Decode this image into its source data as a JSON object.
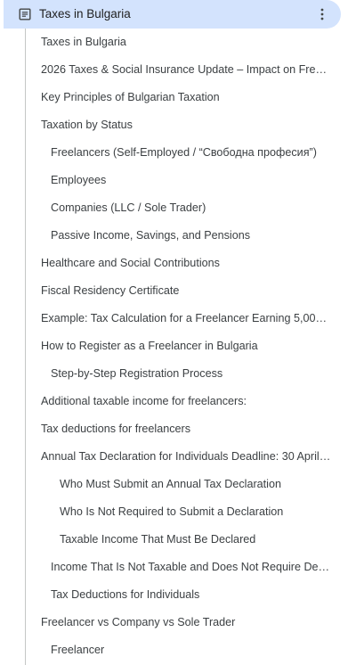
{
  "header": {
    "title": "Taxes in Bulgaria",
    "icon": "document-icon",
    "menu_icon": "more-vert-icon"
  },
  "outline": {
    "items": [
      {
        "label": "Taxes in Bulgaria",
        "level": 0
      },
      {
        "label": "2026 Taxes & Social Insurance Update – Impact on Freel…",
        "level": 0
      },
      {
        "label": "Key Principles of Bulgarian Taxation",
        "level": 0
      },
      {
        "label": "Taxation by Status",
        "level": 0
      },
      {
        "label": "Freelancers (Self-Employed / “Свободна професия”)",
        "level": 1
      },
      {
        "label": "Employees",
        "level": 1
      },
      {
        "label": "Companies (LLC / Sole Trader)",
        "level": 1
      },
      {
        "label": "Passive Income, Savings, and Pensions",
        "level": 1
      },
      {
        "label": "Healthcare and Social Contributions",
        "level": 0
      },
      {
        "label": "Fiscal Residency Certificate",
        "level": 0
      },
      {
        "label": "Example: Tax Calculation for a Freelancer Earning 5,000…",
        "level": 0
      },
      {
        "label": "How to Register as a Freelancer in Bulgaria",
        "level": 0
      },
      {
        "label": "Step-by-Step Registration Process",
        "level": 1
      },
      {
        "label": "Additional taxable income for freelancers:",
        "level": 0
      },
      {
        "label": "Tax deductions for freelancers",
        "level": 0
      },
      {
        "label": "Annual Tax Declaration for Individuals Deadline: 30 April…",
        "level": 0
      },
      {
        "label": "Who Must Submit an Annual Tax Declaration",
        "level": 2
      },
      {
        "label": "Who Is Not Required to Submit a Declaration",
        "level": 2
      },
      {
        "label": "Taxable Income That Must Be Declared",
        "level": 2
      },
      {
        "label": "Income That Is Not Taxable and Does Not Require Decl…",
        "level": 1
      },
      {
        "label": "Tax Deductions for Individuals",
        "level": 1
      },
      {
        "label": "Freelancer vs Company vs Sole Trader",
        "level": 0
      },
      {
        "label": "Freelancer",
        "level": 1
      }
    ]
  },
  "colors": {
    "header_bg": "#d3e3fd",
    "text": "#3c4043",
    "rail": "#c4c7c5"
  }
}
